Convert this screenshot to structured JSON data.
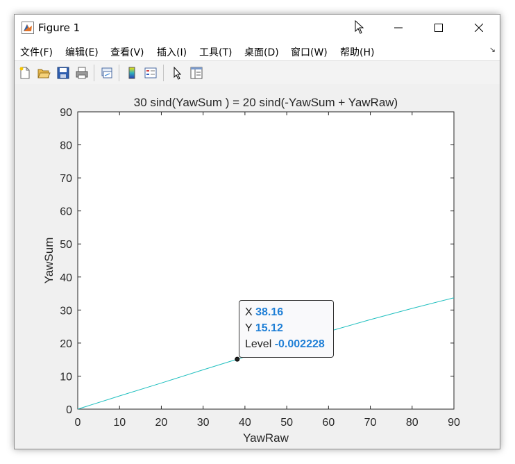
{
  "window": {
    "title": "Figure 1",
    "icon": "matlab-icon",
    "buttons": [
      "minimize-icon",
      "maximize-icon",
      "close-icon"
    ]
  },
  "menu": {
    "items": [
      {
        "label": "文件(F)"
      },
      {
        "label": "编辑(E)"
      },
      {
        "label": "查看(V)"
      },
      {
        "label": "插入(I)"
      },
      {
        "label": "工具(T)"
      },
      {
        "label": "桌面(D)"
      },
      {
        "label": "窗口(W)"
      },
      {
        "label": "帮助(H)"
      }
    ],
    "dock_icon": "dock-arrow-icon"
  },
  "toolbar": {
    "icons": [
      "new-figure-icon",
      "open-file-icon",
      "save-icon",
      "print-icon",
      "link-plot-icon",
      "colorbar-icon",
      "legend-icon",
      "pointer-icon",
      "property-inspector-icon"
    ]
  },
  "datatip": {
    "x_label": "X",
    "x_value": "38.16",
    "y_label": "Y",
    "y_value": "15.12",
    "level_label": "Level",
    "level_value": "-0.002228"
  },
  "chart_data": {
    "type": "line",
    "title": "30 sind(YawSum ) = 20 sind(-YawSum + YawRaw)",
    "xlabel": "YawRaw",
    "ylabel": "YawSum",
    "xlim": [
      0,
      90
    ],
    "ylim": [
      0,
      90
    ],
    "xticks": [
      0,
      10,
      20,
      30,
      40,
      50,
      60,
      70,
      80,
      90
    ],
    "yticks": [
      0,
      10,
      20,
      30,
      40,
      50,
      60,
      70,
      80,
      90
    ],
    "grid": false,
    "line_color": "#1fbfbf",
    "series": [
      {
        "x": [
          0,
          10,
          20,
          30,
          38.16,
          50,
          60,
          70,
          80,
          90
        ],
        "y": [
          0,
          4.0,
          7.9,
          11.9,
          15.12,
          19.7,
          23.5,
          27.1,
          30.5,
          33.7
        ]
      }
    ],
    "marker": {
      "x": 38.16,
      "y": 15.12
    }
  }
}
